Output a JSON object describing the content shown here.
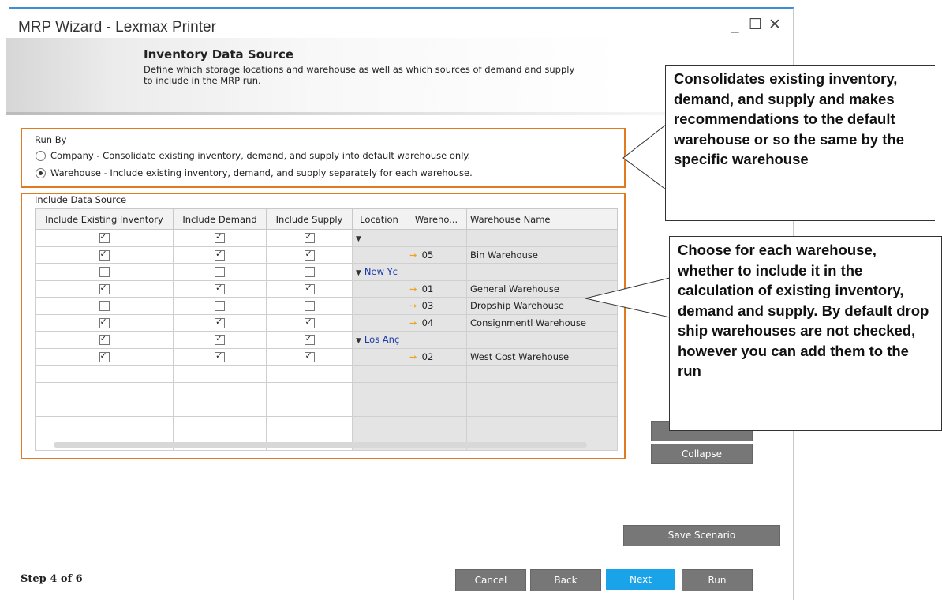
{
  "window": {
    "title": "MRP Wizard - Lexmax Printer",
    "controls": {
      "minimize": "_",
      "maximize": "☐",
      "close": "✕"
    }
  },
  "header": {
    "title": "Inventory Data Source",
    "description": "Define which storage locations and warehouse as well as which sources of demand and supply to include in the MRP run."
  },
  "run_by": {
    "label": "Run By",
    "options": [
      {
        "label": "Company - Consolidate existing inventory, demand, and supply into default warehouse only.",
        "selected": false
      },
      {
        "label": "Warehouse - Include existing inventory, demand, and supply separately for each warehouse.",
        "selected": true
      }
    ]
  },
  "data_source": {
    "label": "Include Data Source",
    "columns": [
      "Include Existing Inventory",
      "Include Demand",
      "Include Supply",
      "Location",
      "Wareho...",
      "Warehouse Name"
    ],
    "rows": [
      {
        "inv": true,
        "dem": true,
        "sup": true,
        "location": "",
        "expander": true,
        "code": "",
        "name": ""
      },
      {
        "inv": true,
        "dem": true,
        "sup": true,
        "location": "",
        "expander": false,
        "code": "05",
        "name": "Bin Warehouse"
      },
      {
        "inv": false,
        "dem": false,
        "sup": false,
        "location": "New Yc",
        "expander": true,
        "code": "",
        "name": ""
      },
      {
        "inv": true,
        "dem": true,
        "sup": true,
        "location": "",
        "expander": false,
        "code": "01",
        "name": "General Warehouse"
      },
      {
        "inv": false,
        "dem": false,
        "sup": false,
        "location": "",
        "expander": false,
        "code": "03",
        "name": "Dropship Warehouse"
      },
      {
        "inv": true,
        "dem": true,
        "sup": true,
        "location": "",
        "expander": false,
        "code": "04",
        "name": "Consignmentl Warehouse"
      },
      {
        "inv": true,
        "dem": true,
        "sup": true,
        "location": "Los Anç",
        "expander": true,
        "code": "",
        "name": ""
      },
      {
        "inv": true,
        "dem": true,
        "sup": true,
        "location": "",
        "expander": false,
        "code": "02",
        "name": "West Cost Warehouse"
      }
    ],
    "empty_rows": 5
  },
  "side_buttons": {
    "expand": "",
    "collapse": "Collapse",
    "save_scenario": "Save Scenario"
  },
  "footer": {
    "step": "Step 4 of 6",
    "cancel": "Cancel",
    "back": "Back",
    "next": "Next",
    "run": "Run"
  },
  "callouts": {
    "top": "Consolidates existing inventory, demand, and supply and makes recommendations to the default warehouse or so the same by the specific warehouse",
    "bottom": "Choose for each warehouse, whether to include it in the calculation of existing inventory, demand and supply. By default drop ship warehouses are not checked, however you can add them to the run"
  },
  "colors": {
    "accent": "#1aa3e8",
    "highlight_box": "#e07b22",
    "location_text": "#1b3aa8",
    "arrow": "#f0a020",
    "title_border": "#3c8fd6"
  }
}
